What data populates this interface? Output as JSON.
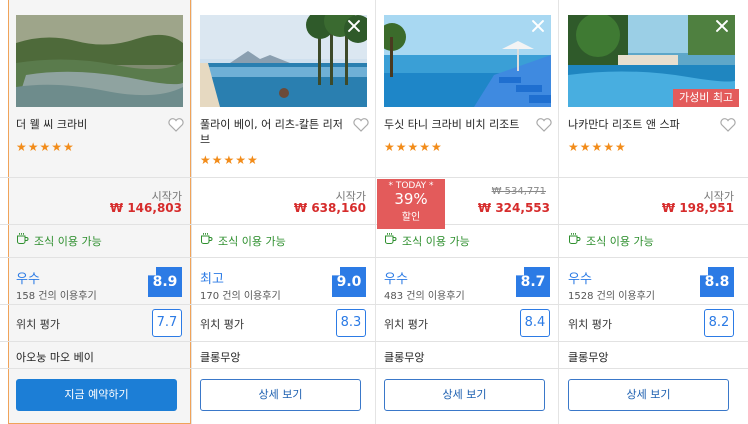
{
  "colors": {
    "accent": "#2c7be5",
    "price": "#d62c2c",
    "breakfast": "#2e8f2e",
    "stars": "#f28c1a",
    "badge": "#e35b5b"
  },
  "hotels": [
    {
      "name": "더 웰 씨 크라비",
      "stars": "★★★★★",
      "price_label": "시작가",
      "price": "₩ 146,803",
      "breakfast": "조식 이용 가능",
      "rating_word": "우수",
      "reviews": "158 건의 이용후기",
      "score": "8.9",
      "location_label": "위치 평가",
      "location_score": "7.7",
      "area": "아오눙 마오 베이",
      "button": "지금 예약하기"
    },
    {
      "name": "풀라이 베이, 어 리츠-칼튼 리저브",
      "stars": "★★★★★",
      "price_label": "시작가",
      "price": "₩ 638,160",
      "breakfast": "조식 이용 가능",
      "rating_word": "최고",
      "reviews": "170 건의 이용후기",
      "score": "9.0",
      "location_label": "위치 평가",
      "location_score": "8.3",
      "area": "클롱무앙",
      "button": "상세 보기"
    },
    {
      "name": "두싯 타니 크라비 비치 리조트",
      "stars": "★★★★★",
      "today_label": "* TODAY *",
      "discount": "39%",
      "discount_word": "할인",
      "old_price": "₩ 534,771",
      "price": "₩ 324,553",
      "breakfast": "조식 이용 가능",
      "rating_word": "우수",
      "reviews": "483 건의 이용후기",
      "score": "8.7",
      "location_label": "위치 평가",
      "location_score": "8.4",
      "area": "클롱무앙",
      "button": "상세 보기"
    },
    {
      "name": "나카만다 리조트 앤 스파",
      "stars": "★★★★★",
      "badge": "가성비 최고",
      "price_label": "시작가",
      "price": "₩ 198,951",
      "breakfast": "조식 이용 가능",
      "rating_word": "우수",
      "reviews": "1528 건의 이용후기",
      "score": "8.8",
      "location_label": "위치 평가",
      "location_score": "8.2",
      "area": "클롱무앙",
      "button": "상세 보기"
    }
  ]
}
